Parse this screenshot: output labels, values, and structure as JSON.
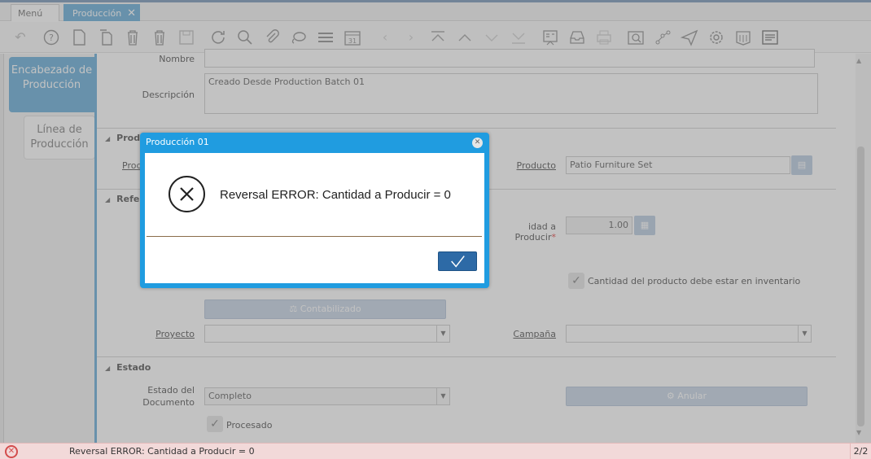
{
  "tabs": {
    "menu_label": "Menú (1)",
    "current_label": "Producción"
  },
  "toolbar": {
    "icons": [
      "undo-icon",
      "help-icon",
      "new-icon",
      "copy-icon",
      "delete-icon",
      "delete-selection-icon",
      "save-icon",
      "refresh-icon",
      "find-icon",
      "attachment-icon",
      "chat-icon",
      "grid-toggle-icon",
      "calendar-icon",
      "previous-record-icon",
      "next-record-icon",
      "first-record-icon",
      "parent-record-icon",
      "detail-record-icon",
      "last-record-icon",
      "report-icon",
      "archive-icon",
      "print-icon",
      "zoom-across-icon",
      "workflow-icon",
      "request-icon",
      "process-icon",
      "product-info-icon",
      "window-info-icon"
    ],
    "calendar_day": "31"
  },
  "side_tabs": {
    "header": "Encabezado de Producción",
    "line": "Línea de Producción"
  },
  "form": {
    "nombre_label": "Nombre",
    "nombre_value": "",
    "descripcion_label": "Descripción",
    "descripcion_value": "Creado Desde Production Batch 01",
    "section_product": "Prod",
    "producto_left_label": "Prod",
    "producto_label": "Producto",
    "producto_value": "Patio Furniture Set",
    "section_ref": "Refer",
    "cantidad_label": "idad a Producir",
    "cantidad_value": "1.00",
    "inventario_label": "Cantidad del producto debe estar en inventario",
    "contabilizado_button": "Contabilizado",
    "proyecto_label": "Proyecto",
    "campana_label": "Campaña",
    "section_estado": "Estado",
    "estado_doc_label_1": "Estado del",
    "estado_doc_label_2": "Documento",
    "estado_doc_value": "Completo",
    "anular_button": "Anular",
    "procesado_label": "Procesado"
  },
  "dialog": {
    "title": "Producción 01",
    "message": "Reversal ERROR: Cantidad a Producir = 0"
  },
  "status": {
    "message": "Reversal ERROR: Cantidad a Producir = 0",
    "page": "2/2"
  },
  "colors": {
    "accent": "#5ba7d6",
    "dialog_header": "#209ce0",
    "ok_button": "#2d6aa6",
    "error_bar": "#f2d9d9"
  }
}
